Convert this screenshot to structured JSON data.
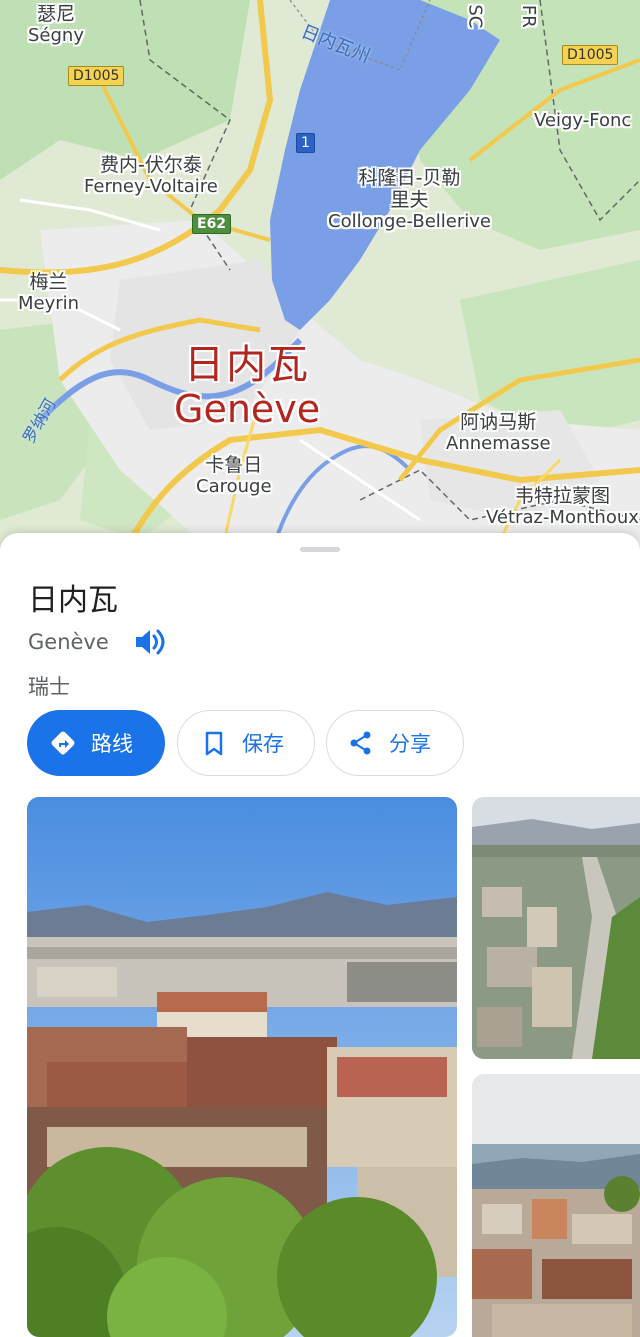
{
  "map": {
    "labels": {
      "segny": {
        "zh": "瑟尼",
        "fr": "Ségny"
      },
      "ferney": {
        "zh": "费内-伏尔泰",
        "fr": "Ferney-Voltaire"
      },
      "meyrin": {
        "zh": "梅兰",
        "fr": "Meyrin"
      },
      "geneve": {
        "zh": "日内瓦",
        "fr": "Genève"
      },
      "carouge": {
        "zh": "卡鲁日",
        "fr": "Carouge"
      },
      "collonge": {
        "zh": "科隆日-贝勒",
        "zh2": "里夫",
        "fr": "Collonge-Bellerive"
      },
      "annemasse": {
        "zh": "阿讷马斯",
        "fr": "Annemasse"
      },
      "vetraz": {
        "zh": "韦特拉蒙图",
        "fr": "Vétraz-Monthoux"
      },
      "veigy": {
        "fr": "Veigy-Fonc"
      },
      "lake": "日内瓦州",
      "river": "罗纳河",
      "edge_sc": "SC",
      "edge_fr": "FR"
    },
    "roads": {
      "d1005_left": "D1005",
      "d1005_right": "D1005",
      "e62": "E62",
      "route1": "1"
    }
  },
  "sheet": {
    "title": "日内瓦",
    "local_name": "Genève",
    "country": "瑞士",
    "buttons": {
      "directions": "路线",
      "save": "保存",
      "share": "分享"
    },
    "icons": {
      "speaker": "speaker-icon",
      "directions": "directions-icon",
      "save": "bookmark-icon",
      "share": "share-icon"
    }
  },
  "colors": {
    "accent": "#1a73e8",
    "city_label": "#b3261e",
    "water": "#7a9fe6"
  }
}
